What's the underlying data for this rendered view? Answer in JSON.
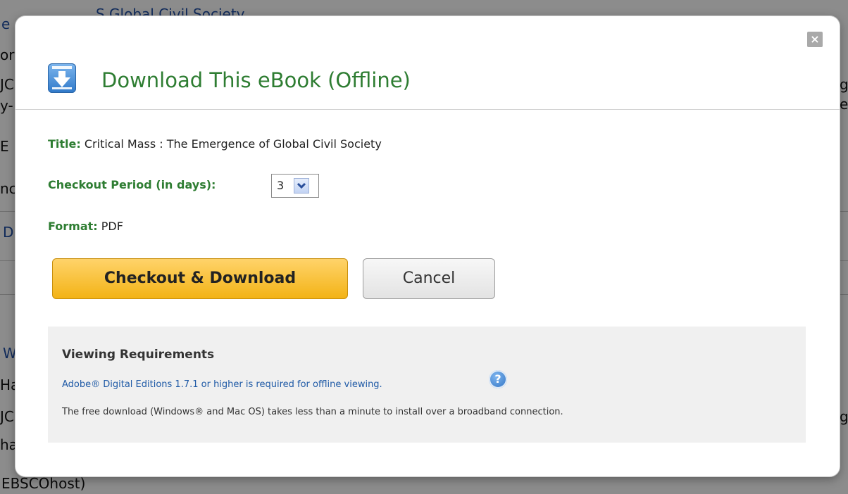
{
  "background": {
    "fragments": [
      "e",
      "S Global Civil Society",
      "or",
      "JC",
      "y-",
      "E",
      "nc",
      "D",
      "W",
      "Ha",
      "JC",
      "ha",
      "EBSCOhost)",
      "g",
      "e;",
      "g"
    ]
  },
  "modal": {
    "close_icon": "close-icon",
    "title": "Download This eBook (Offline)",
    "title_label": "Title:",
    "title_value": "Critical Mass : The Emergence of Global Civil Society",
    "period_label": "Checkout Period (in days):",
    "period_value": "3",
    "format_label": "Format:",
    "format_value": "PDF",
    "checkout_button": "Checkout & Download",
    "cancel_button": "Cancel",
    "requirements": {
      "heading": "Viewing Requirements",
      "link": "Adobe® Digital Editions 1.7.1 or higher is required for offline viewing.",
      "help": "?",
      "note": "The free download (Windows® and Mac OS) takes less than a minute to install over a broadband connection."
    }
  },
  "colors": {
    "title_green": "#2e7d32",
    "checkout_yellow": "#f3b316",
    "link_blue": "#1f5aa6"
  }
}
